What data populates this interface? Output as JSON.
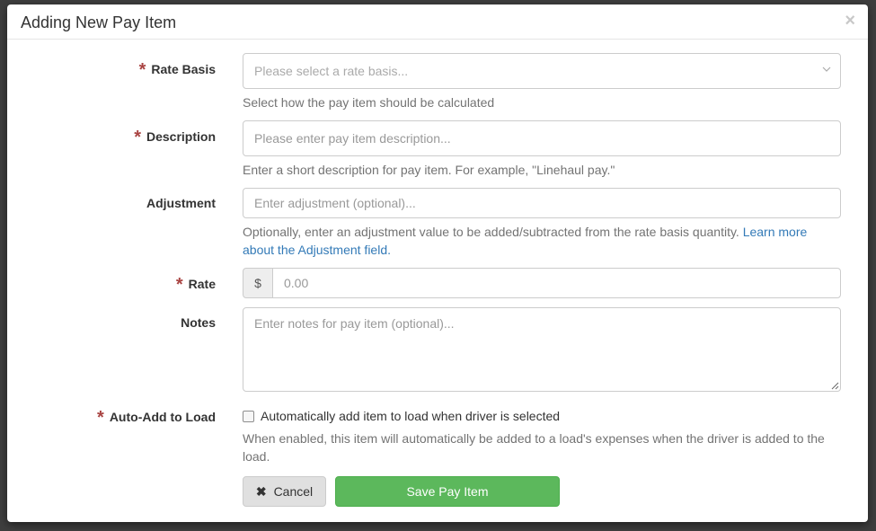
{
  "modal": {
    "title": "Adding New Pay Item",
    "close_symbol": "×"
  },
  "form": {
    "rate_basis": {
      "label": "Rate Basis",
      "required_mark": "*",
      "placeholder": "Please select a rate basis...",
      "help": "Select how the pay item should be calculated"
    },
    "description": {
      "label": "Description",
      "required_mark": "*",
      "placeholder": "Please enter pay item description...",
      "help": "Enter a short description for pay item. For example, \"Linehaul pay.\""
    },
    "adjustment": {
      "label": "Adjustment",
      "placeholder": "Enter adjustment (optional)...",
      "help": "Optionally, enter an adjustment value to be added/subtracted from the rate basis quantity.",
      "help_link": "Learn more about the Adjustment field."
    },
    "rate": {
      "label": "Rate",
      "required_mark": "*",
      "currency_symbol": "$",
      "placeholder": "0.00"
    },
    "notes": {
      "label": "Notes",
      "placeholder": "Enter notes for pay item  (optional)..."
    },
    "auto_add": {
      "label": "Auto-Add to Load",
      "required_mark": "*",
      "checkbox_label": "Automatically add item to load when driver is selected",
      "checked": false,
      "help": "When enabled, this item will automatically be added to a load's expenses when the driver is added to the load."
    }
  },
  "actions": {
    "cancel_label": "Cancel",
    "save_label": "Save Pay Item"
  },
  "colors": {
    "required": "#a94442",
    "link": "#337ab7",
    "save_button": "#5cb85c"
  }
}
